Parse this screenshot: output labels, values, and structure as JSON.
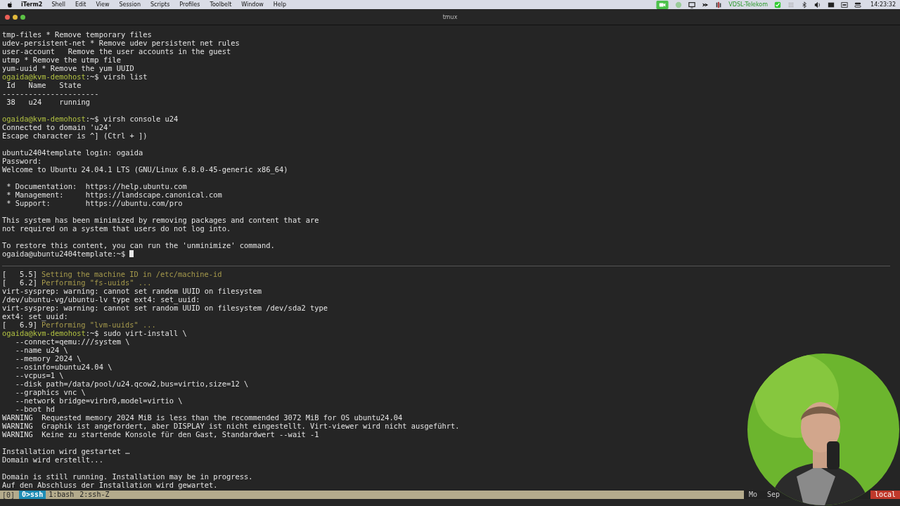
{
  "menu_bar": {
    "app": "iTerm2",
    "items": [
      "Shell",
      "Edit",
      "View",
      "Session",
      "Scripts",
      "Profiles",
      "Toolbelt",
      "Window",
      "Help"
    ],
    "network": "VDSL-Telekom",
    "clock": "14:23:32"
  },
  "window": {
    "title": "tmux"
  },
  "panes": [
    {
      "lines": [
        {
          "segments": [
            {
              "kind": "text",
              "text": "tmp-files * Remove temporary files"
            }
          ]
        },
        {
          "segments": [
            {
              "kind": "text",
              "text": "udev-persistent-net * Remove udev persistent net rules"
            }
          ]
        },
        {
          "segments": [
            {
              "kind": "text",
              "text": "user-account   Remove the user accounts in the guest"
            }
          ]
        },
        {
          "segments": [
            {
              "kind": "text",
              "text": "utmp * Remove the utmp file"
            }
          ]
        },
        {
          "segments": [
            {
              "kind": "text",
              "text": "yum-uuid * Remove the yum UUID"
            }
          ]
        },
        {
          "segments": [
            {
              "kind": "prompt",
              "text": "ogaida@kvm-demohost"
            },
            {
              "kind": "text",
              "text": ":~$ virsh list"
            }
          ]
        },
        {
          "segments": [
            {
              "kind": "text",
              "text": " Id   Name   State"
            }
          ]
        },
        {
          "segments": [
            {
              "kind": "text",
              "text": "----------------------"
            }
          ]
        },
        {
          "segments": [
            {
              "kind": "text",
              "text": " 38   u24    running"
            }
          ]
        },
        {
          "gap_before": true,
          "segments": [
            {
              "kind": "prompt",
              "text": "ogaida@kvm-demohost"
            },
            {
              "kind": "text",
              "text": ":~$ virsh console u24"
            }
          ]
        },
        {
          "segments": [
            {
              "kind": "text",
              "text": "Connected to domain 'u24'"
            }
          ]
        },
        {
          "segments": [
            {
              "kind": "text",
              "text": "Escape character is ^] (Ctrl + ])"
            }
          ]
        },
        {
          "gap_before": true,
          "segments": [
            {
              "kind": "text",
              "text": "ubuntu2404template login: ogaida"
            }
          ]
        },
        {
          "segments": [
            {
              "kind": "text",
              "text": "Password:"
            }
          ]
        },
        {
          "segments": [
            {
              "kind": "text",
              "text": "Welcome to Ubuntu 24.04.1 LTS (GNU/Linux 6.8.0-45-generic x86_64)"
            }
          ]
        },
        {
          "gap_before": true,
          "segments": [
            {
              "kind": "text",
              "text": " * Documentation:  https://help.ubuntu.com"
            }
          ]
        },
        {
          "segments": [
            {
              "kind": "text",
              "text": " * Management:     https://landscape.canonical.com"
            }
          ]
        },
        {
          "segments": [
            {
              "kind": "text",
              "text": " * Support:        https://ubuntu.com/pro"
            }
          ]
        },
        {
          "gap_before": true,
          "segments": [
            {
              "kind": "text",
              "text": "This system has been minimized by removing packages and content that are"
            }
          ]
        },
        {
          "segments": [
            {
              "kind": "text",
              "text": "not required on a system that users do not log into."
            }
          ]
        },
        {
          "gap_before": true,
          "segments": [
            {
              "kind": "text",
              "text": "To restore this content, you can run the 'unminimize' command."
            }
          ]
        },
        {
          "cursor": true,
          "segments": [
            {
              "kind": "text",
              "text": "ogaida@ubuntu2404template:~$"
            }
          ]
        }
      ]
    },
    {
      "lines": [
        {
          "segments": [
            {
              "kind": "text",
              "text": "[   5.5]"
            },
            {
              "kind": "info",
              "text": "Setting the machine ID in /etc/machine-id"
            }
          ]
        },
        {
          "segments": [
            {
              "kind": "text",
              "text": "[   6.2]"
            },
            {
              "kind": "info",
              "text": "Performing \"fs-uuids\" ..."
            }
          ]
        },
        {
          "segments": [
            {
              "kind": "text",
              "text": "virt-sysprep: warning: cannot set random UUID on filesystem"
            }
          ]
        },
        {
          "segments": [
            {
              "kind": "text",
              "text": "/dev/ubuntu-vg/ubuntu-lv type ext4: set_uuid:"
            }
          ]
        },
        {
          "segments": [
            {
              "kind": "text",
              "text": "virt-sysprep: warning: cannot set random UUID on filesystem /dev/sda2 type"
            }
          ]
        },
        {
          "segments": [
            {
              "kind": "text",
              "text": "ext4: set_uuid:"
            }
          ]
        },
        {
          "segments": [
            {
              "kind": "text",
              "text": "[   6.9]"
            },
            {
              "kind": "info",
              "text": "Performing \"lvm-uuids\" ..."
            }
          ]
        },
        {
          "segments": [
            {
              "kind": "prompt",
              "text": "ogaida@kvm-demohost"
            },
            {
              "kind": "text",
              "text": ":~$ sudo virt-install \\"
            }
          ]
        },
        {
          "segments": [
            {
              "kind": "text",
              "text": "   --connect=qemu:///system \\"
            }
          ]
        },
        {
          "segments": [
            {
              "kind": "text",
              "text": "   --name u24 \\"
            }
          ]
        },
        {
          "segments": [
            {
              "kind": "text",
              "text": "   --memory 2024 \\"
            }
          ]
        },
        {
          "segments": [
            {
              "kind": "text",
              "text": "   --osinfo=ubuntu24.04 \\"
            }
          ]
        },
        {
          "segments": [
            {
              "kind": "text",
              "text": "   --vcpus=1 \\"
            }
          ]
        },
        {
          "segments": [
            {
              "kind": "text",
              "text": "   --disk path=/data/pool/u24.qcow2,bus=virtio,size=12 \\"
            }
          ]
        },
        {
          "segments": [
            {
              "kind": "text",
              "text": "   --graphics vnc \\"
            }
          ]
        },
        {
          "segments": [
            {
              "kind": "text",
              "text": "   --network bridge=virbr0,model=virtio \\"
            }
          ]
        },
        {
          "segments": [
            {
              "kind": "text",
              "text": "   --boot hd"
            }
          ]
        },
        {
          "segments": [
            {
              "kind": "text",
              "text": "WARNING  Requested memory 2024 MiB is less than the recommended 3072 MiB for OS ubuntu24.04"
            }
          ]
        },
        {
          "segments": [
            {
              "kind": "text",
              "text": "WARNING  Graphik ist angefordert, aber DISPLAY ist nicht eingestellt. Virt-viewer wird nicht ausgeführt."
            }
          ]
        },
        {
          "segments": [
            {
              "kind": "text",
              "text": "WARNING  Keine zu startende Konsole für den Gast, Standardwert --wait -1"
            }
          ]
        },
        {
          "gap_before": true,
          "segments": [
            {
              "kind": "text",
              "text": "Installation wird gestartet …"
            }
          ]
        },
        {
          "segments": [
            {
              "kind": "text",
              "text": "Domain wird erstellt..."
            }
          ]
        },
        {
          "gap_before": true,
          "segments": [
            {
              "kind": "text",
              "text": "Domain is still running. Installation may be in progress."
            }
          ]
        },
        {
          "segments": [
            {
              "kind": "text",
              "text": "Auf den Abschluss der Installation wird gewartet."
            }
          ]
        }
      ]
    }
  ],
  "status_bar": {
    "session": "[0]",
    "windows": [
      {
        "label": "0>ssh",
        "selected": true
      },
      {
        "label": "1:bash",
        "selected": false
      },
      {
        "label": "2:ssh-Z",
        "selected": false
      }
    ],
    "right": [
      {
        "kind": "plain",
        "text": "Mo"
      },
      {
        "kind": "plain",
        "text": "Sep"
      },
      {
        "kind": "alert",
        "text": "local"
      }
    ]
  }
}
